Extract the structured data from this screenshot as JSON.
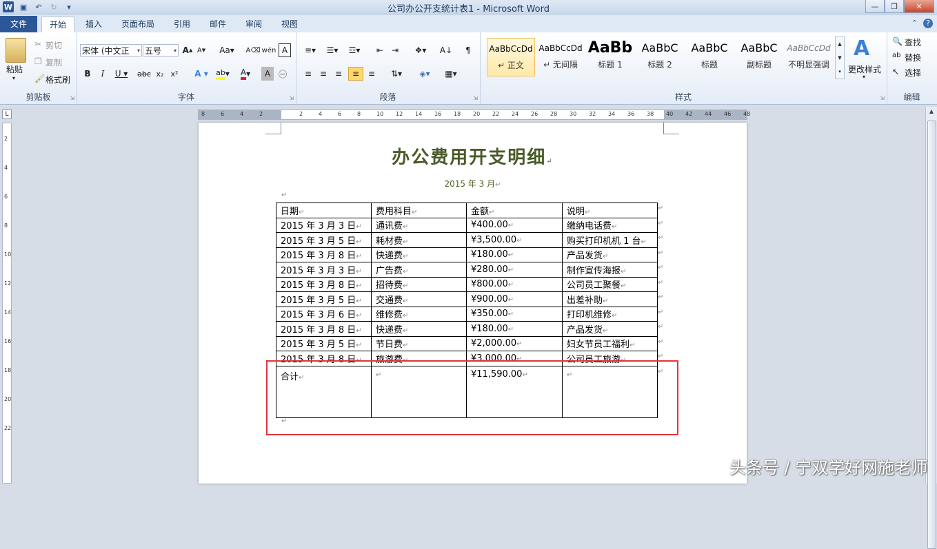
{
  "window": {
    "title": "公司办公开支统计表1 - Microsoft Word"
  },
  "tabs": [
    {
      "label": "文件"
    },
    {
      "label": "开始"
    },
    {
      "label": "插入"
    },
    {
      "label": "页面布局"
    },
    {
      "label": "引用"
    },
    {
      "label": "邮件"
    },
    {
      "label": "审阅"
    },
    {
      "label": "视图"
    }
  ],
  "ribbon": {
    "clipboard": {
      "paste": "粘贴",
      "cut": "剪切",
      "copy": "复制",
      "format_painter": "格式刷",
      "label": "剪贴板"
    },
    "font": {
      "font_name": "宋体 (中文正",
      "font_size": "五号",
      "label": "字体"
    },
    "paragraph": {
      "label": "段落"
    },
    "styles": {
      "items": [
        {
          "sample": "AaBbCcDd",
          "name": "↵ 正文"
        },
        {
          "sample": "AaBbCcDd",
          "name": "↵ 无间隔"
        },
        {
          "sample": "AaBb",
          "name": "标题 1"
        },
        {
          "sample": "AaBbC",
          "name": "标题 2"
        },
        {
          "sample": "AaBbC",
          "name": "标题"
        },
        {
          "sample": "AaBbC",
          "name": "副标题"
        },
        {
          "sample": "AaBbCcDd",
          "name": "不明显强调"
        }
      ],
      "change_styles": "更改样式",
      "label": "样式"
    },
    "editing": {
      "find": "查找",
      "replace": "替换",
      "select": "选择",
      "label": "编辑"
    }
  },
  "ruler": {
    "h_left": [
      "8",
      "6",
      "4",
      "2"
    ],
    "h_right": [
      "2",
      "4",
      "6",
      "8",
      "10",
      "12",
      "14",
      "16",
      "18",
      "20",
      "22",
      "24",
      "26",
      "28",
      "30",
      "32",
      "34",
      "36",
      "38",
      "40",
      "42",
      "44",
      "46",
      "48"
    ],
    "v": [
      "2",
      "4",
      "6",
      "8",
      "10",
      "12",
      "14",
      "16",
      "18",
      "20",
      "22"
    ]
  },
  "document": {
    "title": "办公费用开支明细",
    "subtitle": "2015 年 3 月",
    "table": {
      "headers": [
        "日期",
        "费用科目",
        "金额",
        "说明"
      ],
      "rows": [
        [
          "2015 年 3 月 3 日",
          "通讯费",
          "¥400.00",
          "缴纳电话费"
        ],
        [
          "2015 年 3 月 5 日",
          "耗材费",
          "¥3,500.00",
          "购买打印机机 1 台"
        ],
        [
          "2015 年 3 月 8 日",
          "快递费",
          "¥180.00",
          "产品发货"
        ],
        [
          "2015 年 3 月 3 日",
          "广告费",
          "¥280.00",
          "制作宣传海报"
        ],
        [
          "2015 年 3 月 8 日",
          "招待费",
          "¥800.00",
          "公司员工聚餐"
        ],
        [
          "2015 年 3 月 5 日",
          "交通费",
          "¥900.00",
          "出差补助"
        ],
        [
          "2015 年 3 月 6 日",
          "维修费",
          "¥350.00",
          "打印机维修"
        ],
        [
          "2015 年 3 月 8 日",
          "快递费",
          "¥180.00",
          "产品发货"
        ],
        [
          "2015 年 3 月 5 日",
          "节日费",
          "¥2,000.00",
          "妇女节员工福利"
        ],
        [
          "2015 年 3 月 8 日",
          "旅游费",
          "¥3,000.00",
          "公司员工旅游"
        ]
      ],
      "total": [
        "合计",
        "",
        "¥11,590.00",
        ""
      ]
    }
  },
  "watermark": "头条号 / 宁双学好网施老师",
  "colors": {
    "highlight": "#e0343a",
    "title": "#4a5a2a",
    "file_tab": "#2b5797"
  }
}
